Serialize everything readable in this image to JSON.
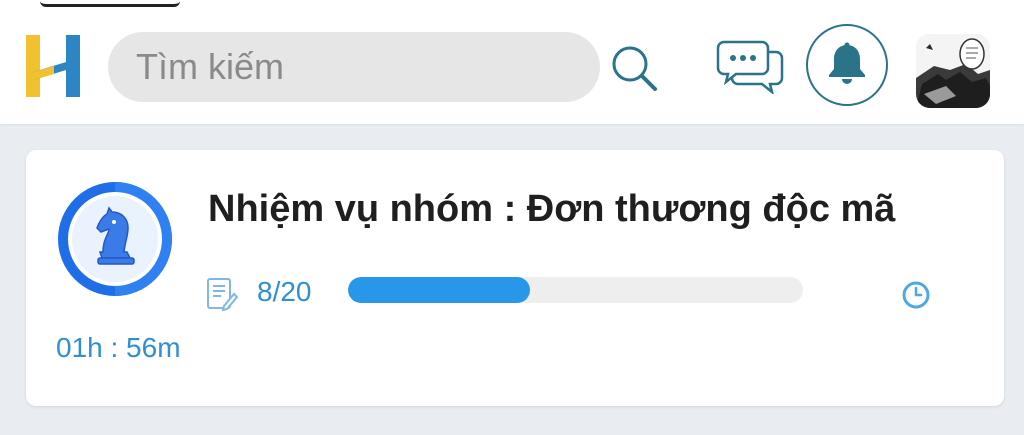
{
  "header": {
    "search": {
      "placeholder": "Tìm kiếm"
    },
    "icons": {
      "logo": "h-logo",
      "search": "search-icon",
      "chat": "chat-icon",
      "notification": "bell-icon",
      "avatar": "avatar-image"
    }
  },
  "mission": {
    "title": "Nhiệm vụ nhóm : Đơn thương độc mã",
    "progress_text": "8/20",
    "progress_value": 0.4,
    "time_remaining": "01h : 56m",
    "icons": {
      "badge": "knight-chess-icon",
      "task": "task-list-icon",
      "clock": "clock-icon"
    }
  },
  "colors": {
    "accent_blue": "#2897ea",
    "text_blue": "#2f8fd3",
    "header_teal": "#2a7388",
    "logo_yellow": "#f2c12e",
    "logo_blue": "#2d86c3"
  }
}
